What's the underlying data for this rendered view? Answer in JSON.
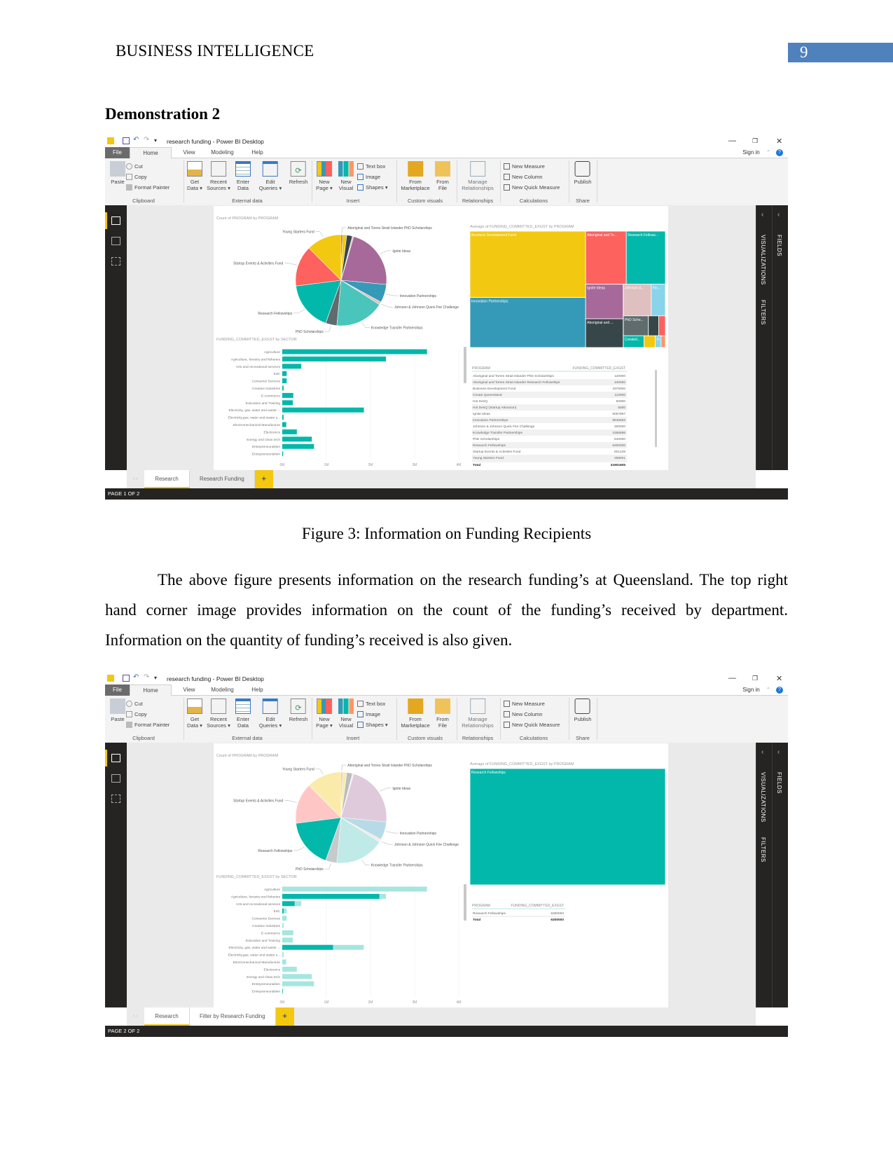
{
  "header": {
    "title": "BUSINESS INTELLIGENCE",
    "page_number": "9"
  },
  "section_heading": "Demonstration 2",
  "figure_caption": "Figure 3: Information on Funding Recipients",
  "paragraph": "The above figure presents information on the research funding’s at Queensland. The top right hand corner image provides information on the count of the funding’s received by department. Information on the quantity of funding’s received is also given.",
  "app": {
    "title": "research funding - Power BI Desktop",
    "menu_tabs": [
      "File",
      "Home",
      "View",
      "Modeling",
      "Help"
    ],
    "sign_in": "Sign in",
    "window_controls": {
      "minimize": "—",
      "maximize": "❐",
      "close": "✕"
    },
    "ribbon": {
      "paste": "Paste",
      "cut": "Cut",
      "copy": "Copy",
      "format_painter": "Format Painter",
      "get_data": "Get\nData ▾",
      "recent_sources": "Recent\nSources ▾",
      "enter_data": "Enter\nData",
      "edit_queries": "Edit\nQueries ▾",
      "refresh": "Refresh",
      "new_page": "New\nPage ▾",
      "new_visual": "New\nVisual",
      "text_box": "Text box",
      "image": "Image",
      "shapes": "Shapes ▾",
      "from_marketplace": "From\nMarketplace",
      "from_file": "From\nFile",
      "manage_relationships": "Manage\nRelationships",
      "new_measure": "New Measure",
      "new_column": "New Column",
      "new_quick_measure": "New Quick Measure",
      "publish": "Publish",
      "groups": [
        "Clipboard",
        "External data",
        "Insert",
        "Custom visuals",
        "Relationships",
        "Calculations",
        "Share"
      ]
    },
    "panes": {
      "visualizations": "VISUALIZATIONS",
      "filters": "FILTERS",
      "fields": "FIELDS"
    },
    "add_page": "+"
  },
  "colors": {
    "accent_yellow": "#F2C811",
    "teal": "#01B8AA",
    "page_number_box": "#4F81BD",
    "chrome_dark": "#252423"
  },
  "pie_slices": [
    {
      "label": "Aboriginal and Torres Strait Islander PhD Scholarships",
      "share_pct": 0.5,
      "color": "#8B2F2F",
      "labeled": true
    },
    {
      "label": "",
      "share_pct": 1.5,
      "color": "#F2C811",
      "labeled": false
    },
    {
      "label": "",
      "share_pct": 2,
      "color": "#374649",
      "labeled": false
    },
    {
      "label": "",
      "share_pct": 0.5,
      "color": "#DFBFBF",
      "labeled": false
    },
    {
      "label": "Ignite Ideas",
      "share_pct": 22,
      "color": "#A66999",
      "labeled": true
    },
    {
      "label": "Innovation Partnerships",
      "share_pct": 6.5,
      "color": "#3599B8",
      "labeled": true
    },
    {
      "label": "Johnson & Johnson Quick Fire Challenge",
      "share_pct": 1,
      "color": "#DFBFBF",
      "labeled": true
    },
    {
      "label": "Knowledge Transfer Partnerships",
      "share_pct": 17.5,
      "color": "#4AC5BB",
      "labeled": true
    },
    {
      "label": "PhD Scholarships",
      "share_pct": 4,
      "color": "#5F6B6D",
      "labeled": true
    },
    {
      "label": "Research Fellowships",
      "share_pct": 17.5,
      "color": "#01B8AA",
      "labeled": true
    },
    {
      "label": "Startup Events & Activities Fund",
      "share_pct": 14.5,
      "color": "#FD625E",
      "labeled": true
    },
    {
      "label": "Young Starters Fund",
      "share_pct": 12.5,
      "color": "#F2C811",
      "labeled": true
    }
  ],
  "shots": [
    {
      "status": "PAGE 1 OF 2",
      "page_tabs": [
        "Research",
        "Research Funding"
      ],
      "pie": {
        "title": "Count of PROGRAM by PROGRAM",
        "highlight": ""
      },
      "bar": {
        "title": "FUNDING_COMMITTED_EXGST by SECTOR",
        "ticks": [
          "0M",
          "1M",
          "2M",
          "3M",
          "4M"
        ],
        "categories": [
          "Agriculture",
          "Agriculture, forestry and fisheries",
          "Arts and recreational services",
          "EdC",
          "Consumer Devices",
          "Creative Industries",
          "E-commerce",
          "Education and Training",
          "Electricity, gas, water and waste ...",
          "Electricity,gas, water and waste s...",
          "Electromechanical Manufacture",
          "Electronics",
          "Energy and clean tech",
          "Entrepreneurialism",
          "Entrepreneurialism"
        ],
        "values_m": [
          3.28,
          2.35,
          0.43,
          0.1,
          0.1,
          0.03,
          0.25,
          0.24,
          1.85,
          0.03,
          0.09,
          0.33,
          0.67,
          0.72,
          0.02
        ],
        "highlight_m": null,
        "xlim_m": [
          0,
          4
        ]
      },
      "treemap": {
        "title": "Average of FUNDING_COMMITTED_EXGST by PROGRAM",
        "tiles": [
          {
            "label": "Business Development Fund",
            "color": "#F2C811"
          },
          {
            "label": "Innovation Partnerships",
            "color": "#3599B8"
          },
          {
            "label": "Aboriginal and To...",
            "color": "#FD625E"
          },
          {
            "label": "Research Fellows...",
            "color": "#01B8AA"
          },
          {
            "label": "Ignite Ideas",
            "color": "#A66999"
          },
          {
            "label": "Johnson &...",
            "color": "#DFBFBF"
          },
          {
            "label": "Fin...",
            "color": "#8AD4EB"
          },
          {
            "label": "Aboriginal and ...",
            "color": "#374649"
          },
          {
            "label": "PhD Scho...",
            "color": "#5F6B6D"
          },
          {
            "label": "",
            "color": "#374649"
          },
          {
            "label": "",
            "color": "#FD625E"
          },
          {
            "label": "Created...",
            "color": "#01B8AA"
          },
          {
            "label": "",
            "color": "#F2C811"
          },
          {
            "label": "Fi...",
            "color": "#8AD4EB"
          },
          {
            "label": "",
            "color": "#FE9666"
          }
        ]
      },
      "table": {
        "headers": [
          "PROGRAM",
          "FUNDING_COMMITTED_EXGST"
        ],
        "rows": [
          [
            "Aboriginal and Torres Strait Islander PhD Scholarships",
            "120000"
          ],
          [
            "Aboriginal and Torres Strait Islander Research Fellowships",
            "340000"
          ],
          [
            "Business Development Fund",
            "3375000"
          ],
          [
            "Create Queensland",
            "110000"
          ],
          [
            "Hot DesQ",
            "50000"
          ],
          [
            "Hot DesQ (Startup Attraction)",
            "6000"
          ],
          [
            "Ignite Ideas",
            "5057887"
          ],
          [
            "Innovation Partnerships",
            "9646692"
          ],
          [
            "Johnson & Johnson Quick Fire Challenge",
            "300000"
          ],
          [
            "Knowledge Transfer Partnerships",
            "1556586"
          ],
          [
            "PhD Scholarships",
            "540000"
          ],
          [
            "Research Fellowships",
            "6300000"
          ],
          [
            "Startup Events & Activities Fund",
            "601439"
          ],
          [
            "Young Starters Fund",
            "258001"
          ]
        ],
        "total": [
          "Total",
          "31901605"
        ]
      }
    },
    {
      "status": "PAGE 2 OF 2",
      "page_tabs": [
        "Research",
        "Filter by Research Funding"
      ],
      "pie": {
        "title": "Count of PROGRAM by PROGRAM",
        "highlight": "Research Fellowships"
      },
      "bar": {
        "title": "FUNDING_COMMITTED_EXGST by SECTOR",
        "ticks": [
          "0M",
          "1M",
          "2M",
          "3M",
          "4M"
        ],
        "categories": [
          "Agriculture",
          "Agriculture, forestry and fisheries",
          "Arts and recreational services",
          "EdC",
          "Consumer Devices",
          "Creative Industries",
          "E-commerce",
          "Education and Training",
          "Electricity, gas, water and waste ...",
          "Electricity,gas, water and waste s...",
          "Electromechanical Manufacture",
          "Electronics",
          "Energy and clean tech",
          "Entrepreneurialism",
          "Entrepreneurialism"
        ],
        "values_m": [
          3.28,
          2.35,
          0.43,
          0.1,
          0.1,
          0.03,
          0.25,
          0.24,
          1.85,
          0.03,
          0.09,
          0.33,
          0.67,
          0.72,
          0.02
        ],
        "highlight_m": [
          0,
          2.2,
          0.28,
          0.03,
          0,
          0,
          0,
          0,
          1.15,
          0,
          0,
          0,
          0,
          0,
          0.01
        ],
        "xlim_m": [
          0,
          4
        ]
      },
      "treemap": {
        "title": "Average of FUNDING_COMMITTED_EXGST by PROGRAM",
        "tiles": [
          {
            "label": "Research Fellowships",
            "color": "#01B8AA"
          }
        ]
      },
      "table": {
        "headers": [
          "PROGRAM",
          "FUNDING_COMMITTED_EXGST"
        ],
        "rows": [
          [
            "Research Fellowships",
            "6300000"
          ]
        ],
        "total": [
          "Total",
          "6300000"
        ]
      }
    }
  ]
}
